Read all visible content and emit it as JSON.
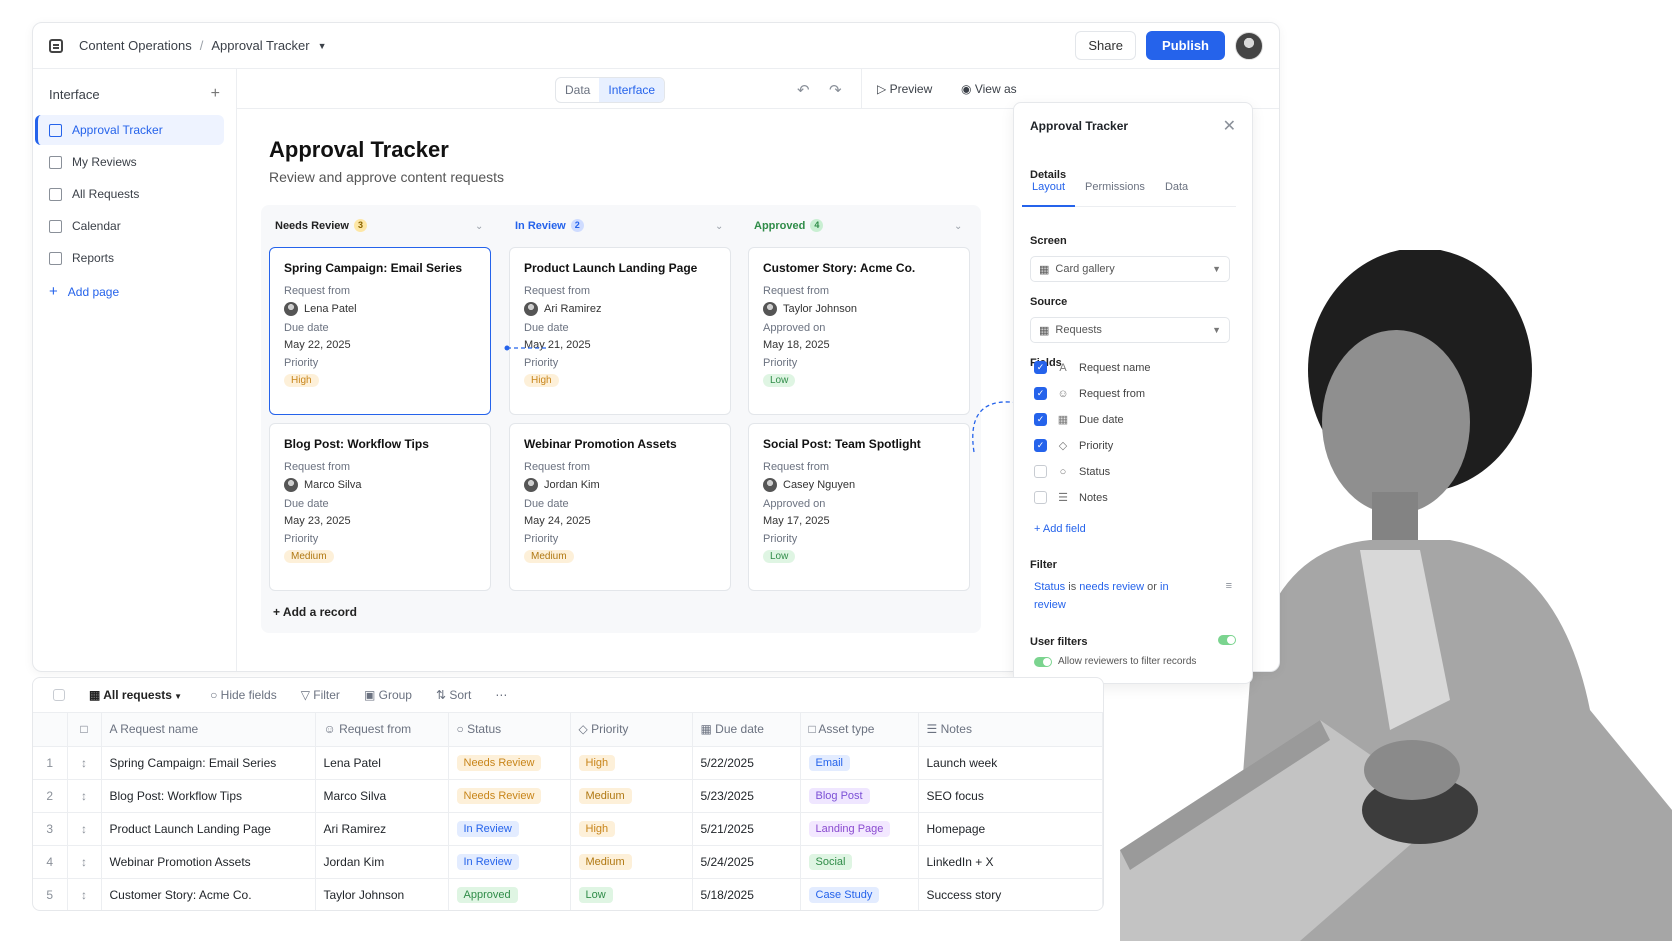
{
  "header": {
    "workspace": "Content Operations",
    "page": "Approval Tracker",
    "share_label": "Share",
    "publish_label": "Publish"
  },
  "sidebar": {
    "heading": "Interface",
    "items": [
      {
        "label": "Approval Tracker"
      },
      {
        "label": "My Reviews"
      },
      {
        "label": "All Requests"
      },
      {
        "label": "Calendar"
      },
      {
        "label": "Reports"
      }
    ],
    "add_label": "Add page"
  },
  "view_toggle": {
    "data": "Data",
    "interface": "Interface",
    "selected": "Interface"
  },
  "actions": {
    "preview": "Preview",
    "view_as": "View as"
  },
  "main": {
    "title": "Approval Tracker",
    "subtitle": "Review and approve content requests",
    "add_record": "Add a record",
    "columns": [
      {
        "name": "Needs Review",
        "count": "3",
        "color": "#222222",
        "badge_bg": "#fde7a6",
        "badge_fg": "#8a6400",
        "cards": [
          {
            "title": "Spring Campaign: Email Series",
            "l1": "Request from",
            "person": "Lena Patel",
            "l2": "Due date",
            "date": "May 22, 2025",
            "l3": "Priority",
            "priority": "High"
          },
          {
            "title": "Blog Post: Workflow Tips",
            "l1": "Request from",
            "person": "Marco Silva",
            "l2": "Due date",
            "date": "May 23, 2025",
            "l3": "Priority",
            "priority": "Medium"
          }
        ]
      },
      {
        "name": "In Review",
        "count": "2",
        "color": "#2563eb",
        "badge_bg": "#cfdcff",
        "badge_fg": "#2563eb",
        "cards": [
          {
            "title": "Product Launch Landing Page",
            "l1": "Request from",
            "person": "Ari Ramirez",
            "l2": "Due date",
            "date": "May 21, 2025",
            "l3": "Priority",
            "priority": "High"
          },
          {
            "title": "Webinar Promotion Assets",
            "l1": "Request from",
            "person": "Jordan Kim",
            "l2": "Due date",
            "date": "May 24, 2025",
            "l3": "Priority",
            "priority": "Medium"
          }
        ]
      },
      {
        "name": "Approved",
        "count": "4",
        "color": "#2f8c48",
        "badge_bg": "#c9efd2",
        "badge_fg": "#2f8c48",
        "cards": [
          {
            "title": "Customer Story: Acme Co.",
            "l1": "Request from",
            "person": "Taylor Johnson",
            "l2": "Approved on",
            "date": "May 18, 2025",
            "l3": "Priority",
            "priority": "Low"
          },
          {
            "title": "Social Post: Team Spotlight",
            "l1": "Request from",
            "person": "Casey Nguyen",
            "l2": "Approved on",
            "date": "May 17, 2025",
            "l3": "Priority",
            "priority": "Low"
          }
        ]
      }
    ]
  },
  "panel": {
    "title": "Approval Tracker",
    "details": "Details",
    "tabs": [
      "Layout",
      "Permissions",
      "Data"
    ],
    "screen_label": "Screen",
    "screen_value": "Card gallery",
    "source_label": "Source",
    "source_value": "Requests",
    "fields_label": "Fields",
    "fields": [
      {
        "name": "Request name",
        "checked": true,
        "icon": "text-icon"
      },
      {
        "name": "Request from",
        "checked": true,
        "icon": "person-icon"
      },
      {
        "name": "Due date",
        "checked": true,
        "icon": "calendar-icon"
      },
      {
        "name": "Priority",
        "checked": true,
        "icon": "tag-icon"
      },
      {
        "name": "Status",
        "checked": false,
        "icon": "circle-icon"
      },
      {
        "name": "Notes",
        "checked": false,
        "icon": "notes-icon"
      }
    ],
    "add_field": "Add field",
    "filter_label": "Filter",
    "filter": {
      "field": "Status",
      "is": "is",
      "v1": "needs review",
      "or": "or",
      "v2": "in review"
    },
    "user_filters_label": "User filters",
    "allow_label": "Allow reviewers to filter records"
  },
  "grid": {
    "view_label": "All requests",
    "tools": [
      "Hide fields",
      "Filter",
      "Group",
      "Sort"
    ],
    "headers": [
      "Request name",
      "Request from",
      "Status",
      "Priority",
      "Due date",
      "Asset type",
      "Notes"
    ],
    "rows": [
      {
        "n": "1",
        "name": "Spring Campaign: Email Series",
        "from": "Lena Patel",
        "status": "Needs Review",
        "priority": "High",
        "due": "5/22/2025",
        "asset": "Email",
        "notes": "Launch week"
      },
      {
        "n": "2",
        "name": "Blog Post: Workflow Tips",
        "from": "Marco Silva",
        "status": "Needs Review",
        "priority": "Medium",
        "due": "5/23/2025",
        "asset": "Blog Post",
        "notes": "SEO focus"
      },
      {
        "n": "3",
        "name": "Product Launch Landing Page",
        "from": "Ari Ramirez",
        "status": "In Review",
        "priority": "High",
        "due": "5/21/2025",
        "asset": "Landing Page",
        "notes": "Homepage"
      },
      {
        "n": "4",
        "name": "Webinar Promotion Assets",
        "from": "Jordan Kim",
        "status": "In Review",
        "priority": "Medium",
        "due": "5/24/2025",
        "asset": "Social",
        "notes": "LinkedIn + X"
      },
      {
        "n": "5",
        "name": "Customer Story: Acme Co.",
        "from": "Taylor Johnson",
        "status": "Approved",
        "priority": "Low",
        "due": "5/18/2025",
        "asset": "Case Study",
        "notes": "Success story"
      }
    ]
  },
  "colors": {
    "accent": "#2563eb",
    "approved": "#2f8c48",
    "warning": "#c8851a"
  }
}
